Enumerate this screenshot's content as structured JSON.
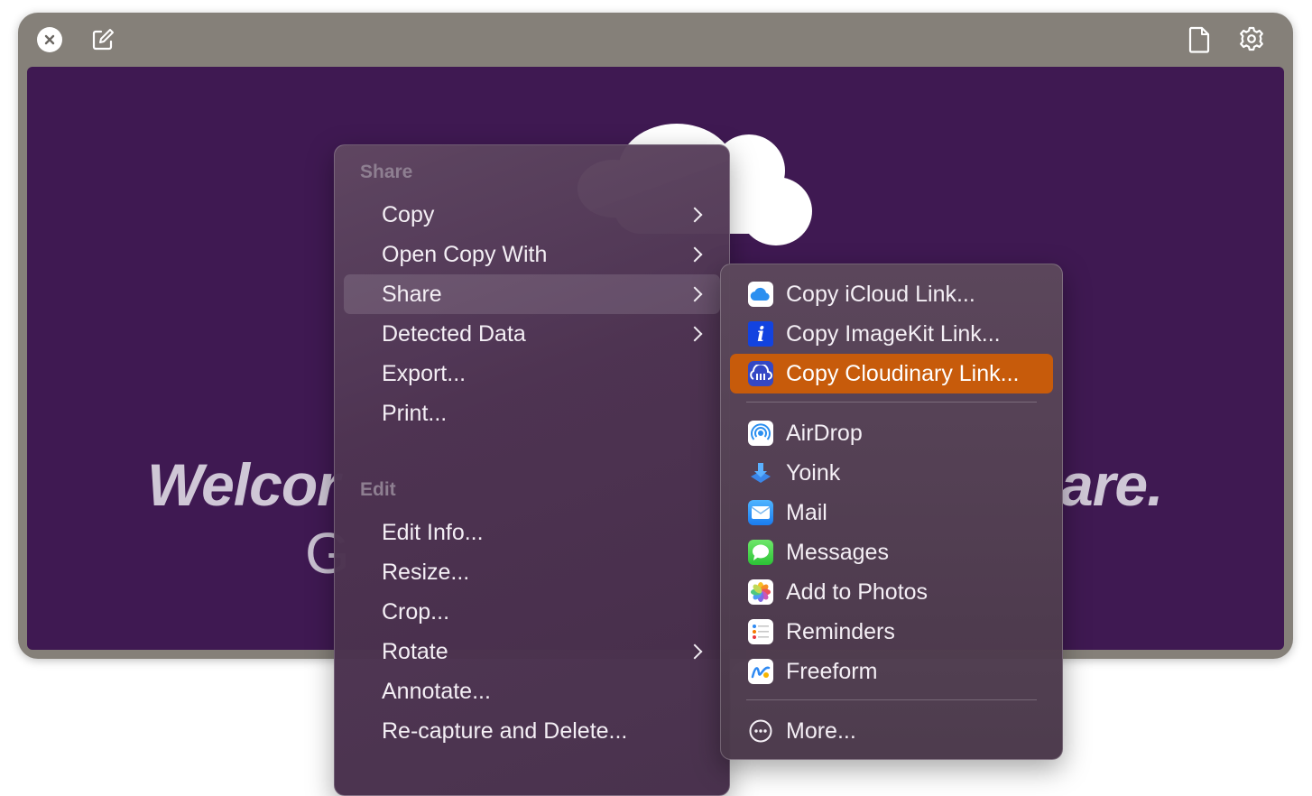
{
  "toolbar": {
    "close_icon": "close-icon",
    "compose_icon": "compose-icon",
    "document_icon": "document-icon",
    "settings_icon": "gear-icon"
  },
  "preview": {
    "background_color": "#3f1952",
    "welcome_left": "Welcor",
    "welcome_right": "are.",
    "subtitle_left": "G"
  },
  "main_menu": {
    "share_header": "Share",
    "edit_header": "Edit",
    "share_items": [
      {
        "label": "Copy",
        "submenu": true
      },
      {
        "label": "Open Copy With",
        "submenu": true
      },
      {
        "label": "Share",
        "submenu": true,
        "highlighted": true
      },
      {
        "label": "Detected Data",
        "submenu": true
      },
      {
        "label": "Export...",
        "submenu": false
      },
      {
        "label": "Print...",
        "submenu": false
      }
    ],
    "edit_items": [
      {
        "label": "Edit Info...",
        "submenu": false
      },
      {
        "label": "Resize...",
        "submenu": false
      },
      {
        "label": "Crop...",
        "submenu": false
      },
      {
        "label": "Rotate",
        "submenu": true
      },
      {
        "label": "Annotate...",
        "submenu": false
      },
      {
        "label": "Re-capture and Delete...",
        "submenu": false
      }
    ]
  },
  "share_menu": {
    "links": [
      {
        "label": "Copy iCloud Link...",
        "icon": "icloud-icon"
      },
      {
        "label": "Copy ImageKit Link...",
        "icon": "imagekit-icon"
      },
      {
        "label": "Copy Cloudinary Link...",
        "icon": "cloudinary-icon",
        "selected": true
      }
    ],
    "apps": [
      {
        "label": "AirDrop",
        "icon": "airdrop-icon"
      },
      {
        "label": "Yoink",
        "icon": "yoink-icon"
      },
      {
        "label": "Mail",
        "icon": "mail-icon"
      },
      {
        "label": "Messages",
        "icon": "messages-icon"
      },
      {
        "label": "Add to Photos",
        "icon": "photos-icon"
      },
      {
        "label": "Reminders",
        "icon": "reminders-icon"
      },
      {
        "label": "Freeform",
        "icon": "freeform-icon"
      }
    ],
    "more": {
      "label": "More...",
      "icon": "more-icon"
    }
  },
  "colors": {
    "selection": "#c75b0b",
    "accent_blue": "#2b7bf0"
  }
}
